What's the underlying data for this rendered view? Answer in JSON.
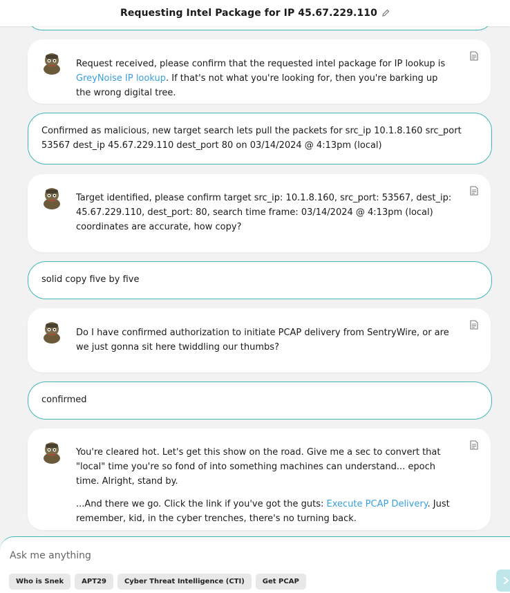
{
  "header": {
    "title": "Requesting Intel Package for IP 45.67.229.110"
  },
  "messages": [
    {
      "role": "bot",
      "text_before": "Request received, please confirm that the requested intel package for IP lookup is ",
      "link": "GreyNoise IP lookup",
      "text_after": ". If that's not what you're looking for, then you're barking up the wrong digital tree."
    },
    {
      "role": "user",
      "text": "Confirmed as malicious, new target search lets pull the packets for src_ip 10.1.8.160 src_port 53567 dest_ip 45.67.229.110 dest_port 80 on 03/14/2024 @ 4:13pm (local)"
    },
    {
      "role": "bot",
      "text": "Target identified, please confirm target src_ip: 10.1.8.160, src_port: 53567, dest_ip: 45.67.229.110, dest_port: 80, search time frame: 03/14/2024 @ 4:13pm (local) coordinates are accurate, how copy?"
    },
    {
      "role": "user",
      "text": "solid copy five by five"
    },
    {
      "role": "bot",
      "text": "Do I have confirmed authorization to initiate PCAP delivery from SentryWire, or are we just gonna sit here twiddling our thumbs?"
    },
    {
      "role": "user",
      "text": "confirmed"
    },
    {
      "role": "bot",
      "p1": "You're cleared hot. Let's get this show on the road. Give me a sec to convert that \"local\" time you're so fond of into something machines can understand... epoch time. Alright, stand by.",
      "p2_before": "...And there we go. Click the link if you've got the guts: ",
      "link": "Execute PCAP Delivery",
      "p2_after": ". Just remember, kid, in the cyber trenches, there's no turning back."
    }
  ],
  "composer": {
    "placeholder": "Ask me anything",
    "chips": [
      "Who is Snek",
      "APT29",
      "Cyber Threat Intelligence (CTI)",
      "Get PCAP"
    ]
  },
  "icons": {
    "pencil": "pencil-icon",
    "doc": "document-icon",
    "send": "send-icon",
    "avatar": "snake-avatar"
  },
  "colors": {
    "accent": "#3fb7b8",
    "link": "#3a9fdc",
    "background": "#f2f2f2"
  }
}
